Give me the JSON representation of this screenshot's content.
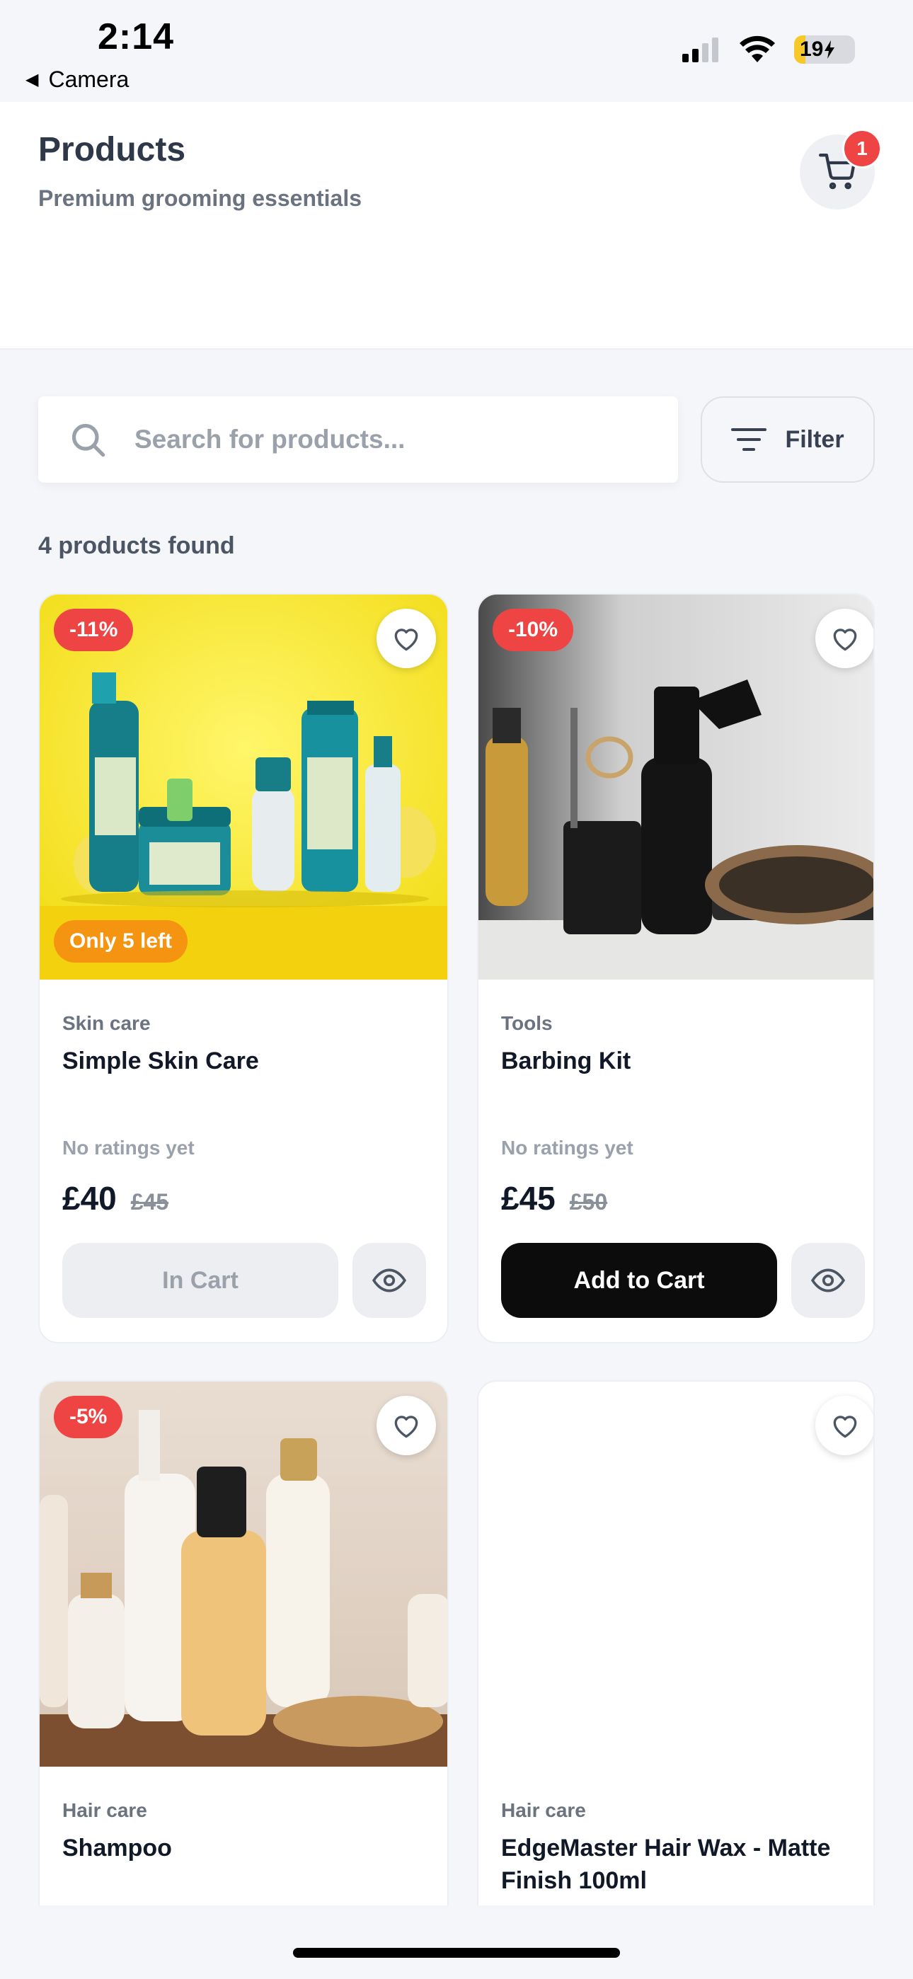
{
  "status_bar": {
    "time": "2:14",
    "back_app": "Camera",
    "battery": "19",
    "battery_level": 0.19
  },
  "header": {
    "title": "Products",
    "subtitle": "Premium grooming essentials",
    "cart_count": "1"
  },
  "search": {
    "placeholder": "Search for products...",
    "filter_label": "Filter"
  },
  "results": {
    "count_text": "4 products found"
  },
  "products": [
    {
      "discount": "-11%",
      "stock_badge": "Only 5 left",
      "category": "Skin care",
      "name": "Simple Skin Care",
      "rating": "No ratings yet",
      "price": "£40",
      "old_price": "£45",
      "cta": "In Cart",
      "cta_state": "in-cart"
    },
    {
      "discount": "-10%",
      "category": "Tools",
      "name": "Barbing Kit",
      "rating": "No ratings yet",
      "price": "£45",
      "old_price": "£50",
      "cta": "Add to Cart",
      "cta_state": "add"
    },
    {
      "discount": "-5%",
      "category": "Hair care",
      "name": "Shampoo"
    },
    {
      "category": "Hair care",
      "name": "EdgeMaster Hair Wax - Matte Finish 100ml"
    }
  ],
  "colors": {
    "background": "#f4f6f9",
    "discount_badge": "#ef4444",
    "stock_badge": "#f59410",
    "primary_button": "#0c0c0c",
    "cart_badge": "#ef4444"
  }
}
